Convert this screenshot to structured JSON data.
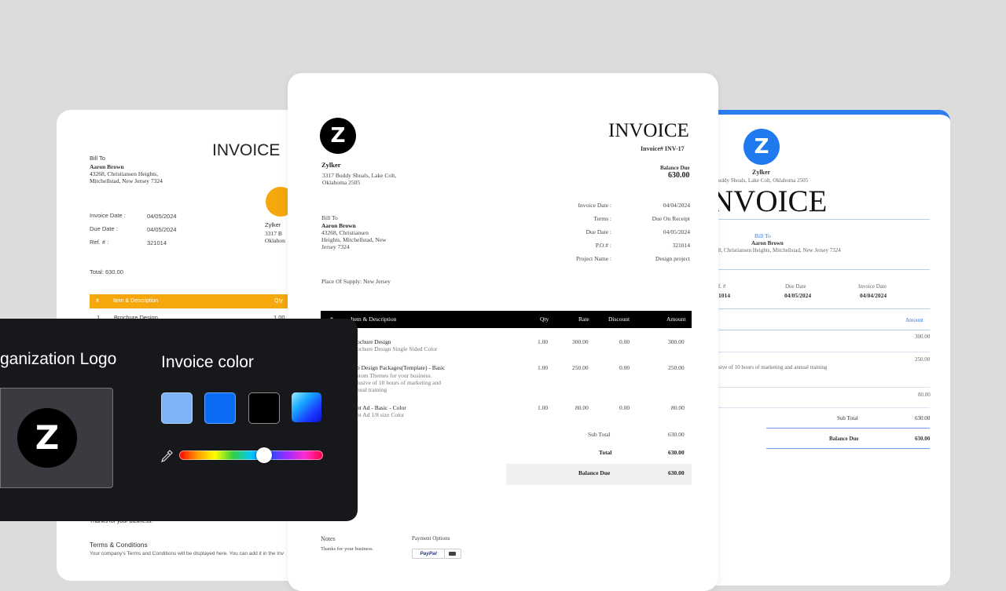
{
  "left_card": {
    "title": "INVOICE",
    "bill_to_label": "Bill To",
    "client_name": "Aaron Brown",
    "client_address_1": "43268, Christiansen Heights,",
    "client_address_2": "Mitchellstad, New Jersey 7324",
    "invoice_date_label": "Invoice Date :",
    "invoice_date_value": "04/05/2024",
    "due_date_label": "Due Date :",
    "due_date_value": "04/05/2024",
    "ref_label": "Ref. # :",
    "ref_value": "321014",
    "company_name": "Zylker",
    "company_address_1": "3317 B",
    "company_address_2": "Oklahon",
    "total": "Total: 630.00",
    "table_header": {
      "num": "#",
      "item": "Item & Description",
      "qty": "Qty"
    },
    "first_row": {
      "num": "1",
      "item": "Brochure Design",
      "qty": "1.00"
    },
    "thanks": "Thanks for your business.",
    "terms_heading": "Terms & Conditions",
    "terms_text": "Your company's Terms and Conditions will be displayed here. You can add it in the Inv",
    "accent_color": "#f5a70c",
    "logo_color": "#f5a70c"
  },
  "center_card": {
    "logo_letter": "Z",
    "title": "INVOICE",
    "invoice_number": "Invoice# INV-17",
    "balance_due_label": "Balance Due",
    "balance_due_value": "630.00",
    "company_name": "Zylker",
    "company_address_1": "3317 Buddy Shoals, Lake Colt,",
    "company_address_2": "Oklahoma 2505",
    "meta": [
      {
        "label": "Invoice Date :",
        "value": "04/04/2024"
      },
      {
        "label": "Terms :",
        "value": "Due On Receipt"
      },
      {
        "label": "Due Date :",
        "value": "04/05/2024"
      },
      {
        "label": "P.O.# :",
        "value": "321014"
      },
      {
        "label": "Project Name :",
        "value": "Design project"
      }
    ],
    "bill_to_label": "Bill To",
    "client_name": "Aaron Brown",
    "client_address_1": "43268, Christiansen",
    "client_address_2": "Heights, Mitchellstad, New",
    "client_address_3": "Jersey 7324",
    "place_of_supply": "Place Of Supply: New Jersey",
    "table_header": {
      "num": "#",
      "item": "Item & Description",
      "qty": "Qty",
      "rate": "Rate",
      "discount": "Discount",
      "amount": "Amount"
    },
    "rows": [
      {
        "item": "ochure Design",
        "desc": [
          "ochure Design Single Sided Color"
        ],
        "qty": "1.00",
        "rate": "300.00",
        "discount": "0.00",
        "amount": "300.00"
      },
      {
        "item": "b Design Packages(Template) - Basic",
        "desc": [
          "stom Themes for your business.",
          "lusive of 10 hours of marketing and",
          "nual training"
        ],
        "qty": "1.00",
        "rate": "250.00",
        "discount": "0.00",
        "amount": "250.00"
      },
      {
        "item": "nt Ad - Basic - Color",
        "desc": [
          "nt Ad 1/8 size Color"
        ],
        "qty": "1.00",
        "rate": "80.00",
        "discount": "0.00",
        "amount": "80.00"
      }
    ],
    "sub_total_label": "Sub Total",
    "sub_total_value": "630.00",
    "total_label": "Total",
    "total_value": "630.00",
    "balance_label": "Balance Due",
    "balance_value": "630.00",
    "notes_label": "Notes",
    "notes_text": "Thanks for your business.",
    "payment_label": "Payment Options",
    "paypal_label": "PayPal"
  },
  "right_card": {
    "logo_letter": "Z",
    "company_name": "Zylker",
    "company_address": "uddy Shoals, Lake Colt, Oklahoma 2505",
    "title": "NVOICE",
    "bill_to_label": "Bill To",
    "client_name": "Aaron Brown",
    "client_address": "8, Christiansen Heights, Mitchellstad, New Jersey 7324",
    "ref_label": "f. #",
    "ref_value": "1014",
    "due_date_label": "Due Date",
    "due_date_value": "04/05/2024",
    "invoice_date_label": "Invoice Date",
    "invoice_date_value": "04/04/2024",
    "amount_label": "Amount",
    "amounts": [
      "300.00",
      "250.00",
      "80.00"
    ],
    "row_desc": "sive of 10 hours of marketing and    annual training",
    "sub_total_label": "Sub Total",
    "sub_total_value": "630.00",
    "balance_label": "Balance Due",
    "balance_value": "630.00",
    "accent_color": "#2d7cf0"
  },
  "panel": {
    "org_logo_label": "ganization Logo",
    "logo_letter": "Z",
    "invoice_color_label": "Invoice color",
    "swatches": [
      "#7fb3f5",
      "#0a6cf2",
      "#000000",
      "gradient-blue"
    ],
    "selected_swatch": "#0a6cf2",
    "color_slider_value": 0.59,
    "eyedropper_icon": "eyedropper-icon"
  }
}
